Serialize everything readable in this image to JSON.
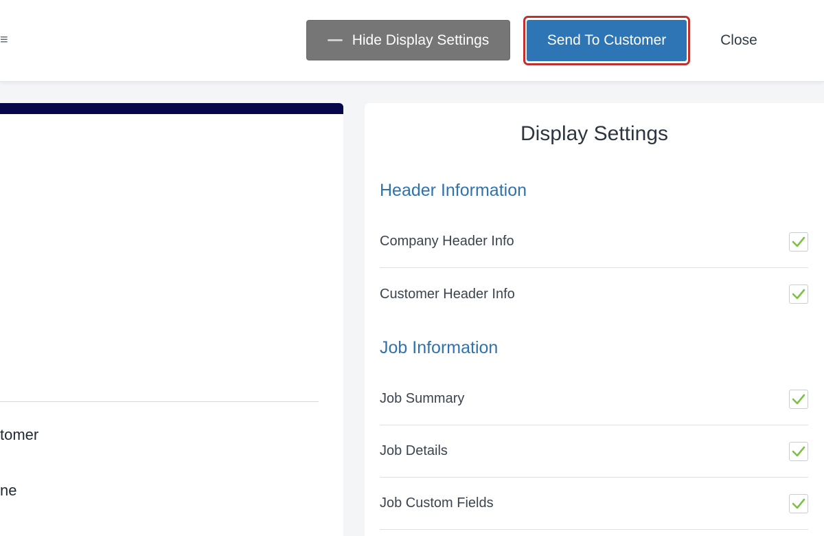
{
  "toolbar": {
    "hide_settings_label": "Hide Display Settings",
    "send_label": "Send To Customer",
    "close_label": "Close"
  },
  "left_preview": {
    "partial_text_1": "tomer",
    "partial_text_2": "ne",
    "header_band_color": "#05064b"
  },
  "display_settings": {
    "title": "Display Settings",
    "sections": [
      {
        "heading": "Header Information",
        "items": [
          {
            "label": "Company Header Info",
            "checked": true
          },
          {
            "label": "Customer Header Info",
            "checked": true
          }
        ]
      },
      {
        "heading": "Job Information",
        "items": [
          {
            "label": "Job Summary",
            "checked": true
          },
          {
            "label": "Job Details",
            "checked": true
          },
          {
            "label": "Job Custom Fields",
            "checked": true
          }
        ]
      }
    ]
  },
  "colors": {
    "primary": "#2d75b4",
    "highlight_outline": "#c0302e",
    "check": "#7cc242",
    "section_heading": "#2f73ae"
  }
}
